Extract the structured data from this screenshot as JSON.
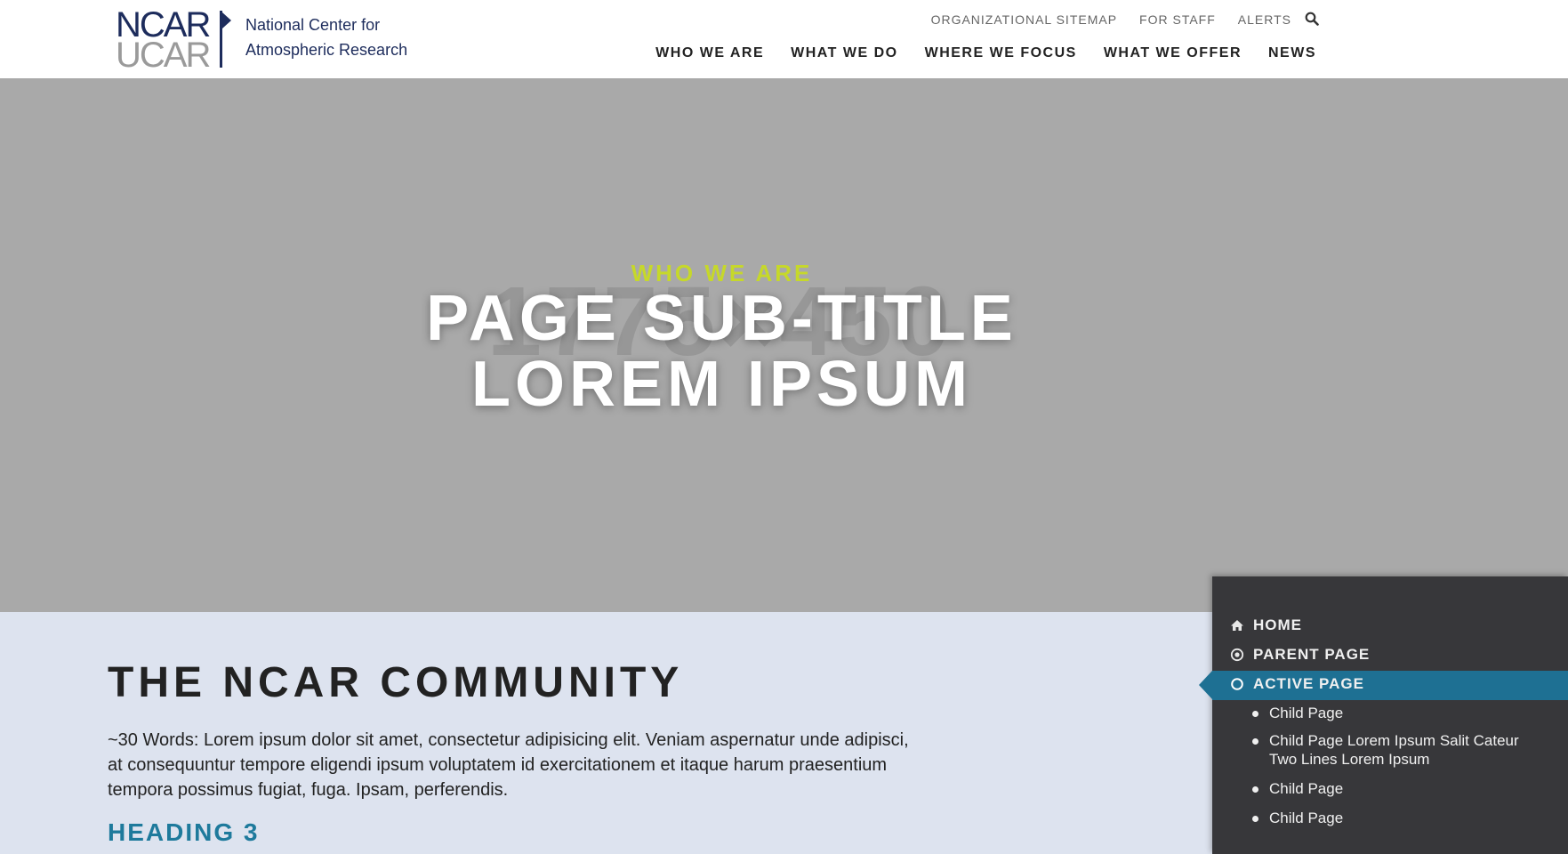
{
  "logo": {
    "ncar": "NCAR",
    "ucar": "UCAR",
    "name_line1": "National Center for",
    "name_line2": "Atmospheric Research"
  },
  "utility_nav": [
    "ORGANIZATIONAL SITEMAP",
    "FOR STAFF",
    "ALERTS"
  ],
  "main_nav": [
    "WHO WE ARE",
    "WHAT WE DO",
    "WHERE WE FOCUS",
    "WHAT WE OFFER",
    "NEWS"
  ],
  "hero": {
    "placeholder": "1775×450",
    "eyebrow": "WHO WE ARE",
    "title_line1": "PAGE SUB-TITLE",
    "title_line2": "LOREM IPSUM"
  },
  "content": {
    "title": "THE NCAR COMMUNITY",
    "lede": "~30 Words: Lorem ipsum dolor sit amet, consectetur adipisicing elit. Veniam aspernatur unde adipisci, at consequuntur tempore eligendi ipsum voluptatem id exercitationem et itaque harum praesentium tempora possimus fugiat, fuga. Ipsam, perferendis.",
    "heading3": "HEADING 3"
  },
  "sidenav": {
    "home": "HOME",
    "parent": "PARENT PAGE",
    "active": "ACTIVE PAGE",
    "children": [
      "Child Page",
      "Child Page Lorem Ipsum Salit Cateur Two Lines Lorem Ipsum",
      "Child Page",
      "Child Page"
    ]
  },
  "colors": {
    "navy": "#1d2c5c",
    "accent_lime": "#c6d82a",
    "teal": "#1e7a9c",
    "active_nav": "#1e7093",
    "content_bg": "#dde3ef",
    "hero_bg": "#a9a9a9",
    "sidenav_bg": "#37373a"
  },
  "icons": {
    "search": "search-icon",
    "home": "home-icon",
    "parent": "target-icon",
    "active": "circle-icon"
  }
}
